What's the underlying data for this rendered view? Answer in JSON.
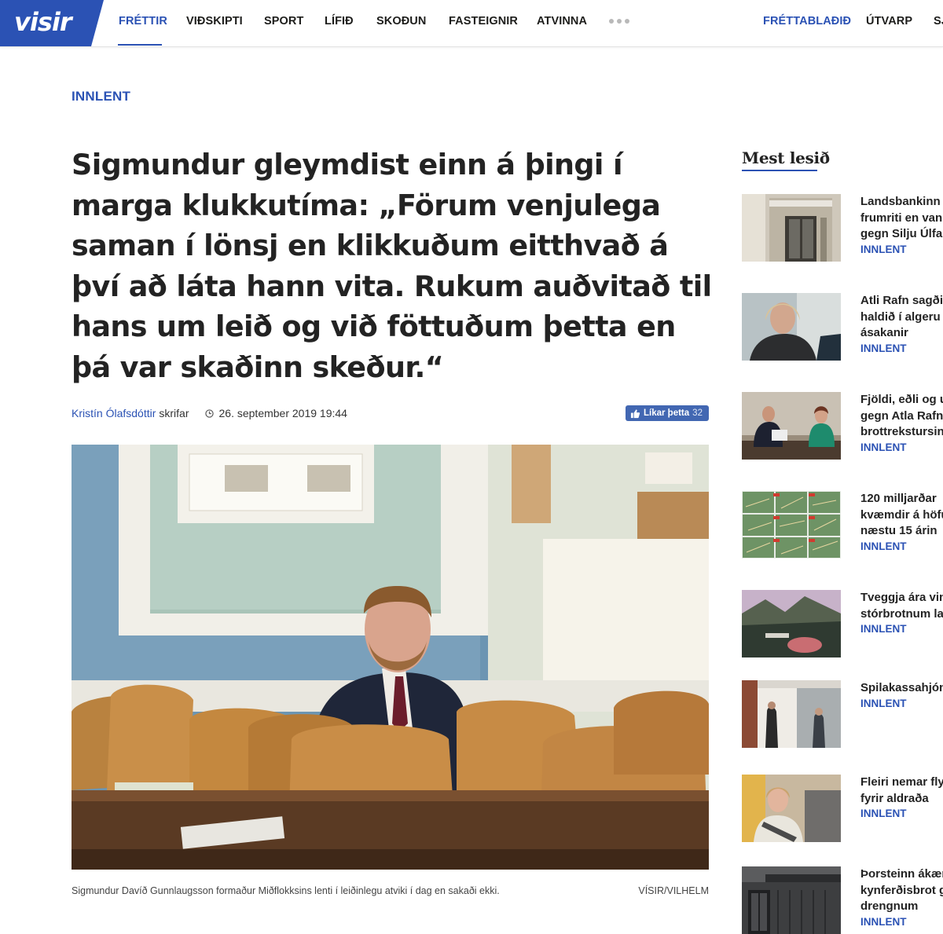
{
  "brand": {
    "logo_text": "visir",
    "accent": "#2b52b4",
    "logo_bg": "#2b52b4"
  },
  "nav": {
    "items": [
      "Fréttir",
      "Viðskipti",
      "Sport",
      "Lífið",
      "Skoðun",
      "Fasteignir",
      "Atvinna"
    ],
    "active": "Fréttir",
    "more_icon": "ellipsis-icon",
    "right_items": [
      "Fréttablaðið",
      "Útvarp",
      "Sj"
    ]
  },
  "article": {
    "category": "Innlent",
    "title": "Sigmundur gleymdist einn á þingi í marga klukkutíma: „Förum venjulega saman í lönsj en klikkuðum eitthvað á því að láta hann vita. Rukum auðvitað til hans um leið og við föttuðum þetta en þá var skaðinn skeður.“",
    "author": "Kristín Ólafsdóttir",
    "author_suffix": "skrifar",
    "timestamp": "26. september 2019 19:44",
    "like_label": "Líkar þetta",
    "like_count": "32",
    "like_color": "#4267b2",
    "image_caption": "Sigmundur Davíð Gunnlaugsson formaður Miðflokksins lenti í leiðinlegu atviki í dag en sakaði ekki.",
    "image_credit": "Vísir/Vilhelm"
  },
  "sidebar": {
    "title": "Mest lesið",
    "items": [
      {
        "lines": [
          "Landsbankinn",
          "frumriti en van",
          "gegn Silju Úlfar"
        ],
        "category": "Innlent"
      },
      {
        "lines": [
          "Atli Rafn sagðis",
          "haldið í algeru",
          "ásakanir"
        ],
        "category": "Innlent"
      },
      {
        "lines": [
          "Fjöldi, eðli og u",
          "gegn Atla Rafni",
          "brottrekstursin"
        ],
        "category": "Innlent"
      },
      {
        "lines": [
          "120 milljarðar",
          "kvæmdir á höfu",
          "næstu 15 árin"
        ],
        "category": "Innlent"
      },
      {
        "lines": [
          "Tveggja ára vin",
          "stórbrotnum la"
        ],
        "category": "Innlent"
      },
      {
        "lines": [
          "Spilakassahjón"
        ],
        "category": "Innlent"
      },
      {
        "lines": [
          "Fleiri nemar fly",
          "fyrir aldraða"
        ],
        "category": "Innlent"
      },
      {
        "lines": [
          "Þorsteinn ákær",
          "kynferðisbrot g",
          "drengnum"
        ],
        "category": "Innlent"
      }
    ]
  }
}
